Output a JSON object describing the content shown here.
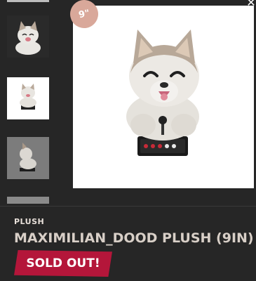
{
  "gallery": {
    "size_badge": "9\"",
    "close_icon": "close-icon",
    "thumbnails": [
      "thumb-1",
      "thumb-2",
      "thumb-3",
      "thumb-4"
    ]
  },
  "product": {
    "category": "PLUSH",
    "title": "MAXIMILIAN_DOOD PLUSH (9IN)",
    "status": "SOLD OUT!"
  },
  "colors": {
    "background": "#2f2f2f",
    "badge": "#d9a89a",
    "sold_out": "#b4163a",
    "title": "#d8cfc7"
  }
}
